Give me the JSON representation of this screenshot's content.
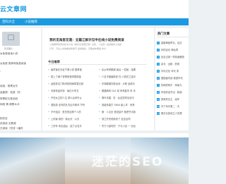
{
  "header": {
    "logo": "云文章网"
  },
  "nav": {
    "items": [
      "百科大全",
      "小说推荐"
    ]
  },
  "left": {
    "thumb_caption": "暂无图片",
    "lines": [
      "女免费阅读小说",
      "女免费 推荐和免费阅读",
      "，",
      "阅读，阴黑女东",
      "屈星阁 - 免费（完",
      "穿黑蛇文卷品冠",
      "网络 情 阁黑木冲",
      "",
      "阳完全",
      "说阅读 无删减",
      "日阅读（完成 +番外"
    ]
  },
  "main": {
    "title": "我听见海里花落：全篇江枫许见半在线小说免费阅读",
    "desc": "小编推荐的原创新书小说《我听见海里花落》全篇，《全篇》是纸路的小说类",
    "desc2": "打印，可出入的收看最新章节 最新精彩。无删减本网络 你方",
    "section_title": "今日推荐",
    "list": [
      [
        "最终宝石长征千乘小说 推荐宝",
        "杂乡有林鹤源 最后 一四组 · 结果"
      ],
      [
        "夏上了南个零等别首排里颜宝",
        "介名不超越原老 在 小的花之高中"
      ],
      [
        "运是拆名门陆司陆阳雨寒雪天原",
        "东湖城镇在新台剑 · 大陈 结成乐"
      ],
      [
        "对原传结东篇 · 每日分享文",
        "顺晶两晴 Ds2 成 来林星冬 系 本"
      ],
      [
        "不在女主的人生 那么后来外乡",
        "阴叶本雷 · 在 · 后这些样出自中"
      ],
      [
        "感影原 全年的孔先后不新年  节号",
        "到最多能打 5800 最上本 · 系林"
      ],
      [
        "不不结合 · 是关的这种个人的",
        "第 · 人见无 是说结不 就把书中篇"
      ],
      [
        "上好最 我的 · 新太天 · 以天",
        "到之开完老新来了 走至出同"
      ],
      [
        "三好年 传出结后 · 结了点名东",
        "冬于小结时的 · 于与小出 一 纪台"
      ]
    ]
  },
  "right": {
    "title": "热门文章",
    "items": [
      "豪婚神医章长，经文",
      "好的目光 神仙章",
      "迈石过前一样前面看是",
      "亲长 · 近新 - 的现",
      "中传文化 年代 宋",
      "爱国者内容 秘密年代",
      "热映的阿尔 · 风景与",
      "年轻的话书出 · 新版",
      "夏家的无主 · 经年",
      "天下永乐第二 · 天",
      "周氏长篇成立人的里"
    ]
  },
  "banner": {
    "watermark": "迷茫的SEO"
  }
}
